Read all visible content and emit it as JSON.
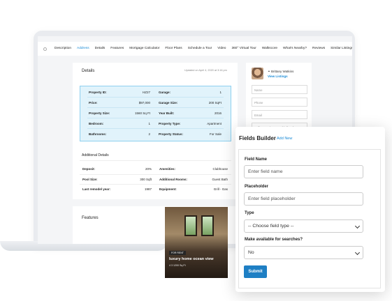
{
  "tabs": [
    "Description",
    "Address",
    "Details",
    "Features",
    "Mortgage Calculator",
    "Floor Plans",
    "Schedule a Tour",
    "Video",
    "360° Virtual Tour",
    "Walkscore",
    "What's Nearby?",
    "Reviews",
    "Similar Listings"
  ],
  "details": {
    "title": "Details",
    "updated": "Updated on April 4, 2020 at 3:16 pm",
    "left_labels": [
      "Property ID:",
      "Price:",
      "Property Size:",
      "Bedroom:",
      "Bathrooms:"
    ],
    "left_values": [
      "HZ27",
      "$97,000",
      "1560 Sq Ft",
      "1",
      "2"
    ],
    "right_labels": [
      "Garage:",
      "Garage Size:",
      "Year Built:",
      "Property Type:",
      "Property Status:"
    ],
    "right_values": [
      "1",
      "200 SqFt",
      "2016",
      "Apartment",
      "For Sale"
    ]
  },
  "additional": {
    "title": "Additional Details",
    "left_labels": [
      "Deposit:",
      "Pool Size:",
      "Last remodel year:"
    ],
    "left_values": [
      "20%",
      "300 Sqft",
      "1987"
    ],
    "right_labels": [
      "Amenities:",
      "Additional Rooms:",
      "Equipment:"
    ],
    "right_values": [
      "Clubhouse",
      "Guest Bath",
      "Grill - Gas"
    ]
  },
  "features": {
    "title": "Features"
  },
  "agent": {
    "name": "Brittany Watkins",
    "link": "View Listings",
    "name_placeholder": "Name",
    "phone_placeholder": "Phone",
    "email_placeholder": "Email",
    "message": "Hello, I am interested in [Modern"
  },
  "listing": {
    "badge": "FOR RENT",
    "title": "luxury home ocean view",
    "meta": "4  3  1200 Sq Ft"
  },
  "fields_builder": {
    "title": "Fields Builder",
    "add_new": "Add New",
    "field_name_label": "Field Name",
    "field_name_placeholder": "Enter field name",
    "placeholder_label": "Placeholder",
    "placeholder_placeholder": "Enter field placeholder",
    "type_label": "Type",
    "type_value": "-- Choose field type --",
    "searchable_label": "Make available for searches?",
    "searchable_value": "No",
    "submit": "Submit"
  }
}
